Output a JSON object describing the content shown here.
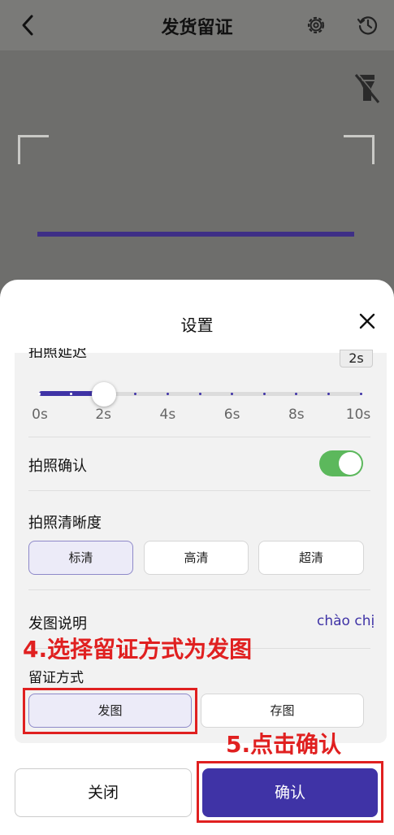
{
  "header": {
    "title": "发货留证"
  },
  "sheet": {
    "title": "设置"
  },
  "delay": {
    "label": "拍照延迟",
    "value_badge": "2s",
    "ticks": [
      "0s",
      "2s",
      "4s",
      "6s",
      "8s",
      "10s"
    ],
    "selected_value": 2,
    "max_value": 10
  },
  "confirm_row": {
    "label": "拍照确认",
    "enabled": true
  },
  "clarity": {
    "label": "拍照清晰度",
    "options": [
      "标清",
      "高清",
      "超清"
    ],
    "selected": "标清"
  },
  "caption": {
    "label": "发图说明",
    "value": "chào chị"
  },
  "method": {
    "label": "留证方式",
    "options": [
      "发图",
      "存图"
    ],
    "selected": "发图"
  },
  "annotations": {
    "step4": "4.选择留证方式为发图",
    "step5": "5.点击确认"
  },
  "footer": {
    "close_label": "关闭",
    "confirm_label": "确认"
  },
  "colors": {
    "accent": "#3f33a6",
    "toggle_on": "#5cb85c",
    "annotation_red": "#e02020"
  },
  "icons": {
    "back": "chevron-left-icon",
    "settings": "gear-icon",
    "history": "history-icon",
    "flash": "flash-off-icon",
    "close": "close-icon"
  }
}
